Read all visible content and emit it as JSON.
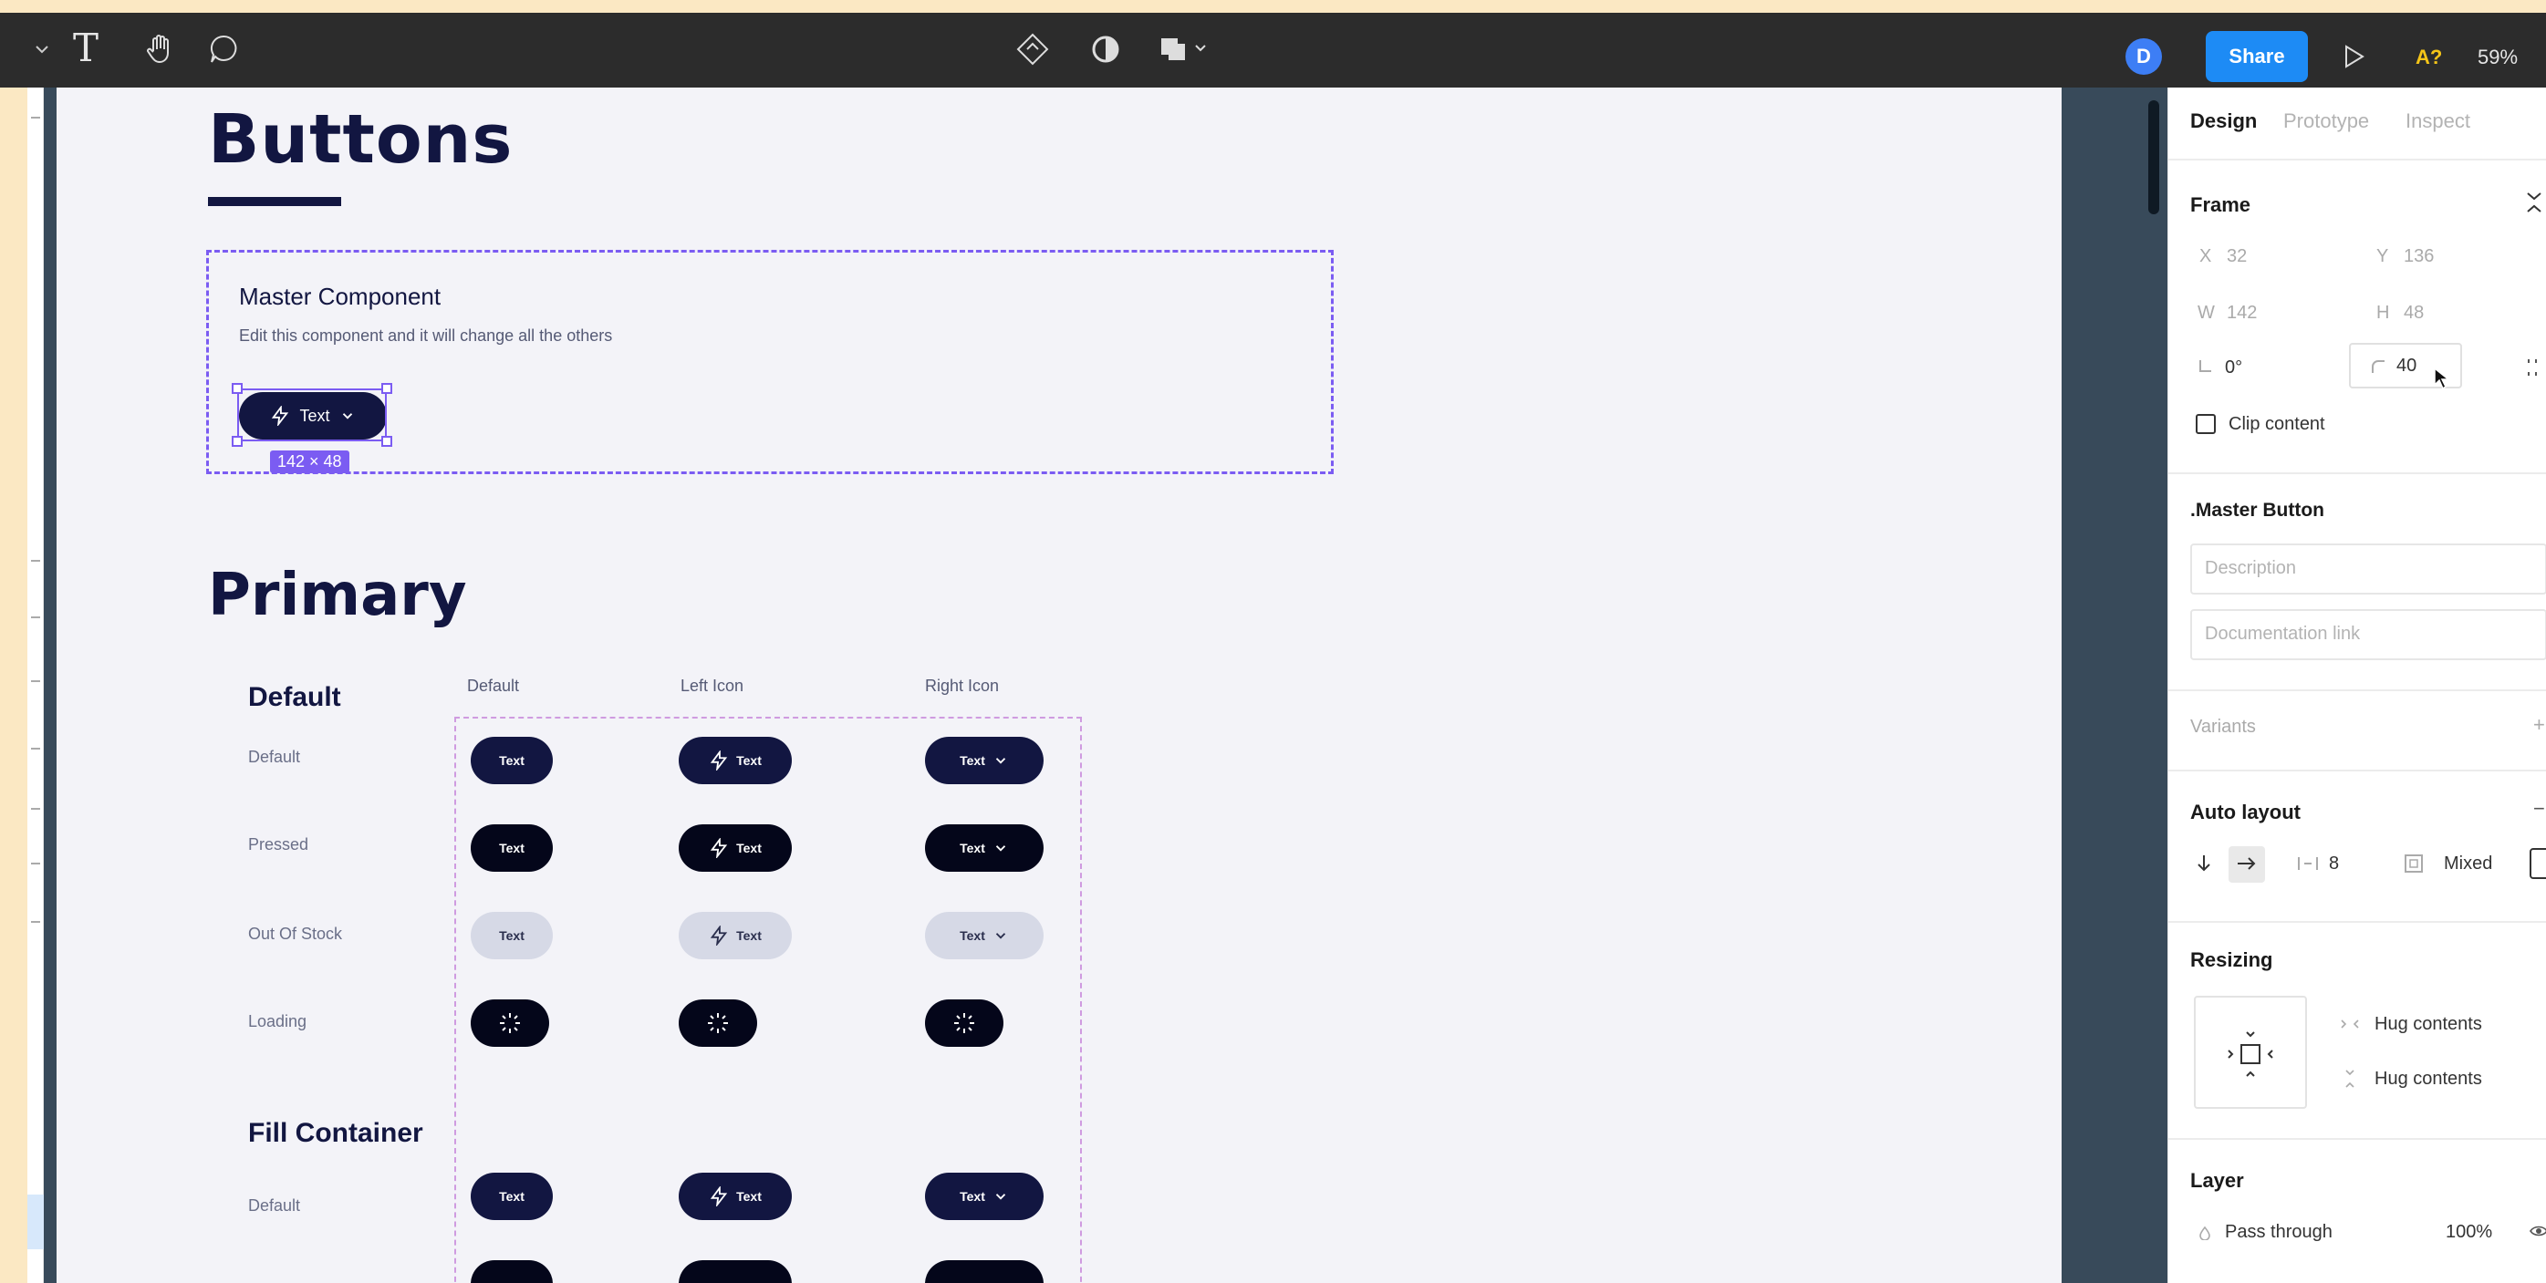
{
  "toolbar": {
    "left_tool_text": "T",
    "avatar_initial": "D",
    "share_label": "Share",
    "a_badge": "A?",
    "zoom": "59%"
  },
  "canvas": {
    "title": "Buttons",
    "master": {
      "title": "Master Component",
      "description": "Edit this component and it will change all the others",
      "button_label": "Text",
      "size_badge": "142 × 48"
    },
    "section_title": "Primary",
    "columns": [
      "Default",
      "Left Icon",
      "Right Icon"
    ],
    "groups": [
      {
        "title": "Default",
        "rows": [
          "Default",
          "Pressed",
          "Out Of Stock",
          "Loading"
        ]
      },
      {
        "title": "Fill Container",
        "rows": [
          "Default"
        ]
      }
    ],
    "button_label": "Text"
  },
  "right_panel": {
    "tabs": [
      "Design",
      "Prototype",
      "Inspect"
    ],
    "active_tab": "Design",
    "frame": {
      "title": "Frame",
      "x_label": "X",
      "x": "32",
      "y_label": "Y",
      "y": "136",
      "w_label": "W",
      "w": "142",
      "h_label": "H",
      "h": "48",
      "rotation": "0°",
      "radius": "40",
      "clip_content": "Clip content"
    },
    "component": {
      "name": ".Master Button",
      "description_placeholder": "Description",
      "doc_link_placeholder": "Documentation link"
    },
    "variants": "Variants",
    "auto_layout": {
      "title": "Auto layout",
      "spacing": "8",
      "padding": "Mixed"
    },
    "resizing": {
      "title": "Resizing",
      "horizontal": "Hug contents",
      "vertical": "Hug contents"
    },
    "layer": {
      "title": "Layer",
      "blend": "Pass through",
      "opacity": "100%"
    }
  }
}
